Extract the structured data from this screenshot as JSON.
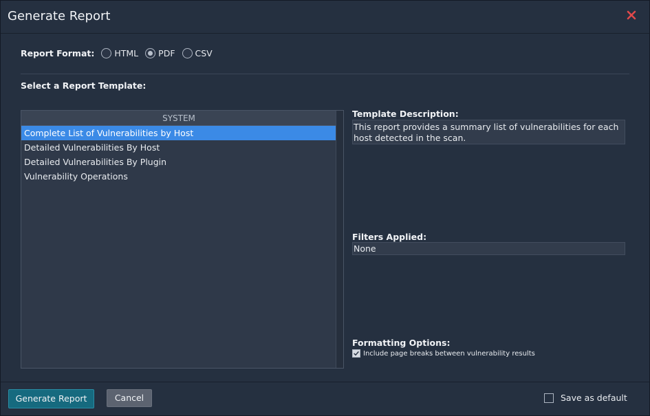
{
  "dialog": {
    "title": "Generate Report"
  },
  "icons": {
    "close": "close-icon",
    "check": "checkmark-icon"
  },
  "colors": {
    "close_icon": "#e0494a",
    "selected_row": "#3b8ae6",
    "primary_button": "#166a7f"
  },
  "report_format": {
    "label": "Report Format:",
    "options": [
      {
        "label": "HTML",
        "checked": false
      },
      {
        "label": "PDF",
        "checked": true
      },
      {
        "label": "CSV",
        "checked": false
      }
    ]
  },
  "template_section": {
    "label": "Select a Report Template:",
    "list_header": "SYSTEM",
    "items": [
      {
        "label": "Complete List of Vulnerabilities by Host",
        "selected": true
      },
      {
        "label": "Detailed Vulnerabilities By Host",
        "selected": false
      },
      {
        "label": "Detailed Vulnerabilities By Plugin",
        "selected": false
      },
      {
        "label": "Vulnerability Operations",
        "selected": false
      }
    ]
  },
  "template_description": {
    "label": "Template Description:",
    "text": "This report provides a summary list of vulnerabilities for each host detected in the scan."
  },
  "filters": {
    "label": "Filters Applied:",
    "value": "None"
  },
  "formatting": {
    "label": "Formatting Options:",
    "page_breaks_label": "Include page breaks between vulnerability results",
    "page_breaks_checked": true
  },
  "footer": {
    "generate_label": "Generate Report",
    "cancel_label": "Cancel",
    "save_default_label": "Save as default",
    "save_default_checked": false
  }
}
